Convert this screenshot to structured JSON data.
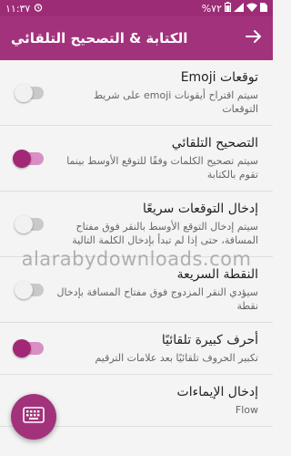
{
  "status": {
    "time": "١١:٣٧",
    "battery": "%٧٢"
  },
  "appbar": {
    "title": "الكتابة & التصحيح التلقائي"
  },
  "items": [
    {
      "title": "توقعات Emoji",
      "subtitle": "سيتم اقتراح أيقونات emoji على شريط التوقعات",
      "toggle": "off"
    },
    {
      "title": "التصحيح التلقائي",
      "subtitle": "سيتم تصحيح الكلمات وفقًا للتوقع الأوسط بينما تقوم بالكتابة",
      "toggle": "on"
    },
    {
      "title": "إدخال التوقعات سريعًا",
      "subtitle": "سيتم إدخال التوقع الأوسط بالنقر فوق مفتاح المسافة، حتى إذا لم تبدأ بإدخال الكلمة التالية",
      "toggle": "off"
    },
    {
      "title": "النقطة السريعة",
      "subtitle": "سيؤدي النقر المزدوج فوق مفتاح المسافة بإدخال نقطة",
      "toggle": "off"
    },
    {
      "title": "أحرف كبيرة تلقائيًا",
      "subtitle": "تكبير الحروف تلقائيًا بعد علامات الترقيم",
      "toggle": "on"
    },
    {
      "title": "إدخال الإيماءات",
      "subtitle": "Flow",
      "toggle": "none"
    }
  ],
  "watermark": "alarabydownloads.com",
  "colors": {
    "primary": "#a3327c",
    "status_bar": "#9c2c76",
    "toggle_on_thumb": "#a22875",
    "toggle_on_track": "#d98fc4",
    "toggle_off_track": "#c9c9c9"
  },
  "icons": {
    "back": "arrow-right-icon",
    "fab": "keyboard-icon"
  }
}
